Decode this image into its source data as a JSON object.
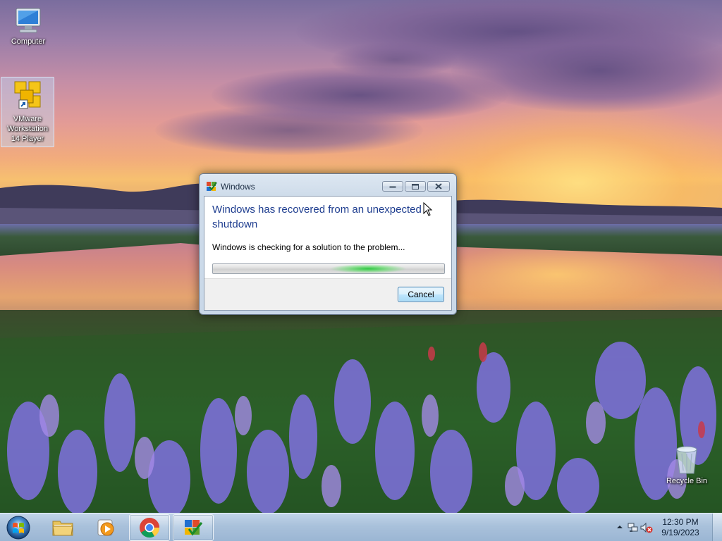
{
  "desktop": {
    "icons": [
      {
        "id": "computer",
        "label": "Computer",
        "icon": "computer-icon"
      },
      {
        "id": "vmware",
        "label": "VMware Workstation 14 Player",
        "label_lines": [
          "VMware",
          "Workstation",
          "14 Player"
        ],
        "icon": "vmware-icon",
        "selected": true
      },
      {
        "id": "recycle",
        "label": "Recycle Bin",
        "icon": "recycle-bin-icon"
      }
    ]
  },
  "dialog": {
    "title": "Windows",
    "title_icon": "windows-error-reporting-icon",
    "headline_line1": "Windows has recovered from an unexpected",
    "headline_line2": "shutdown",
    "message": "Windows is checking for a solution to the problem...",
    "progress": {
      "state": "indeterminate",
      "color": "#2fc83c"
    },
    "cancel_label": "Cancel",
    "caption_buttons": [
      "minimize-icon",
      "maximize-icon",
      "close-icon"
    ]
  },
  "taskbar": {
    "start_icon": "windows-start-orb-icon",
    "buttons": [
      {
        "id": "explorer",
        "icon": "folder-icon",
        "running": false
      },
      {
        "id": "media-player",
        "icon": "media-player-icon",
        "running": false
      },
      {
        "id": "chrome",
        "icon": "chrome-icon",
        "running": true
      },
      {
        "id": "windows-dialog",
        "icon": "windows-error-reporting-icon",
        "running": true
      }
    ],
    "tray": {
      "icons": [
        "show-hidden-icons-chevron",
        "network-icon",
        "volume-muted-icon"
      ],
      "time": "12:30 PM",
      "date": "9/19/2023"
    }
  },
  "colors": {
    "headline": "#1e3d8f",
    "accent_button_border": "#3c7fb1",
    "progress_glow": "#2fc83c"
  }
}
